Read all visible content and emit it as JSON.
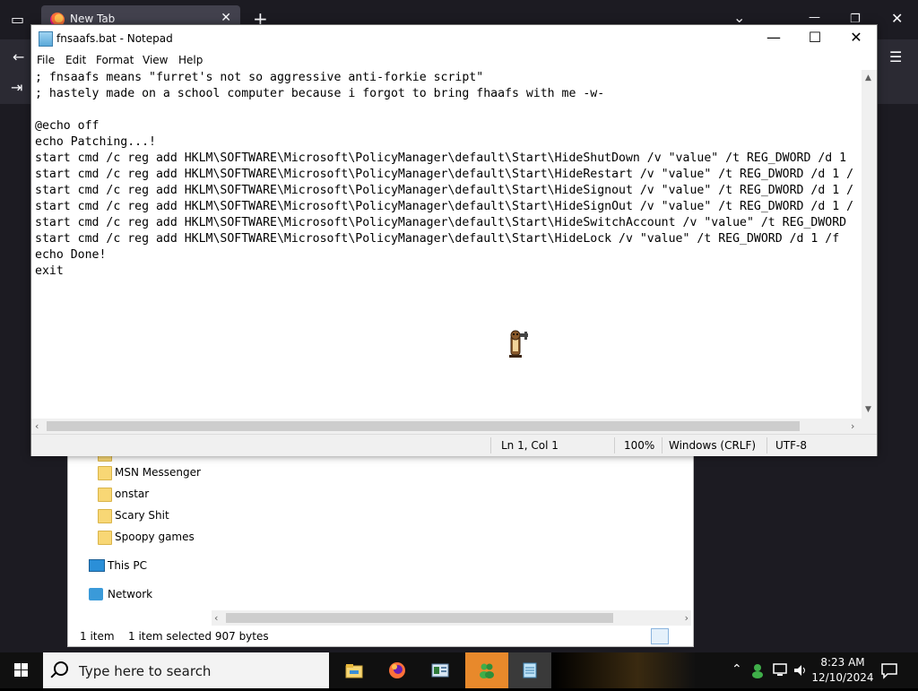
{
  "browser": {
    "tab_title": "New Tab",
    "tab_close": "✕",
    "new_tab": "+",
    "chevron": "⌄",
    "minimize": "—",
    "restore": "❐",
    "close": "✕",
    "menu": "☰"
  },
  "notepad": {
    "title": "fnsaafs.bat - Notepad",
    "menu": [
      "File",
      "Edit",
      "Format",
      "View",
      "Help"
    ],
    "lines": [
      "; fnsaafs means \"furret's not so aggressive anti-forkie script\"",
      "; hastely made on a school computer because i forgot to bring fhaafs with me -w-",
      "",
      "@echo off",
      "echo Patching...!",
      "start cmd /c reg add HKLM\\SOFTWARE\\Microsoft\\PolicyManager\\default\\Start\\HideShutDown /v \"value\" /t REG_DWORD /d 1",
      "start cmd /c reg add HKLM\\SOFTWARE\\Microsoft\\PolicyManager\\default\\Start\\HideRestart /v \"value\" /t REG_DWORD /d 1 /",
      "start cmd /c reg add HKLM\\SOFTWARE\\Microsoft\\PolicyManager\\default\\Start\\HideSignout /v \"value\" /t REG_DWORD /d 1 /",
      "start cmd /c reg add HKLM\\SOFTWARE\\Microsoft\\PolicyManager\\default\\Start\\HideSignOut /v \"value\" /t REG_DWORD /d 1 /",
      "start cmd /c reg add HKLM\\SOFTWARE\\Microsoft\\PolicyManager\\default\\Start\\HideSwitchAccount /v \"value\" /t REG_DWORD",
      "start cmd /c reg add HKLM\\SOFTWARE\\Microsoft\\PolicyManager\\default\\Start\\HideLock /v \"value\" /t REG_DWORD /d 1 /f",
      "echo Done!",
      "exit"
    ],
    "status": {
      "position": "Ln 1, Col 1",
      "zoom": "100%",
      "line_endings": "Windows (CRLF)",
      "encoding": "UTF-8"
    }
  },
  "explorer": {
    "folders": [
      "MSN Messenger",
      "onstar",
      "Scary Shit",
      "Spoopy games"
    ],
    "this_pc": "This PC",
    "network": "Network",
    "status_items": "1 item",
    "status_selected": "1 item selected  907 bytes"
  },
  "taskbar": {
    "search_placeholder": "Type here to search",
    "time": "8:23 AM",
    "date": "12/10/2024",
    "tray_chevron": "⌃"
  },
  "colors": {
    "taskbar_active": "#e8892b",
    "browser_bg": "#1c1b22",
    "folder": "#f8d775"
  }
}
